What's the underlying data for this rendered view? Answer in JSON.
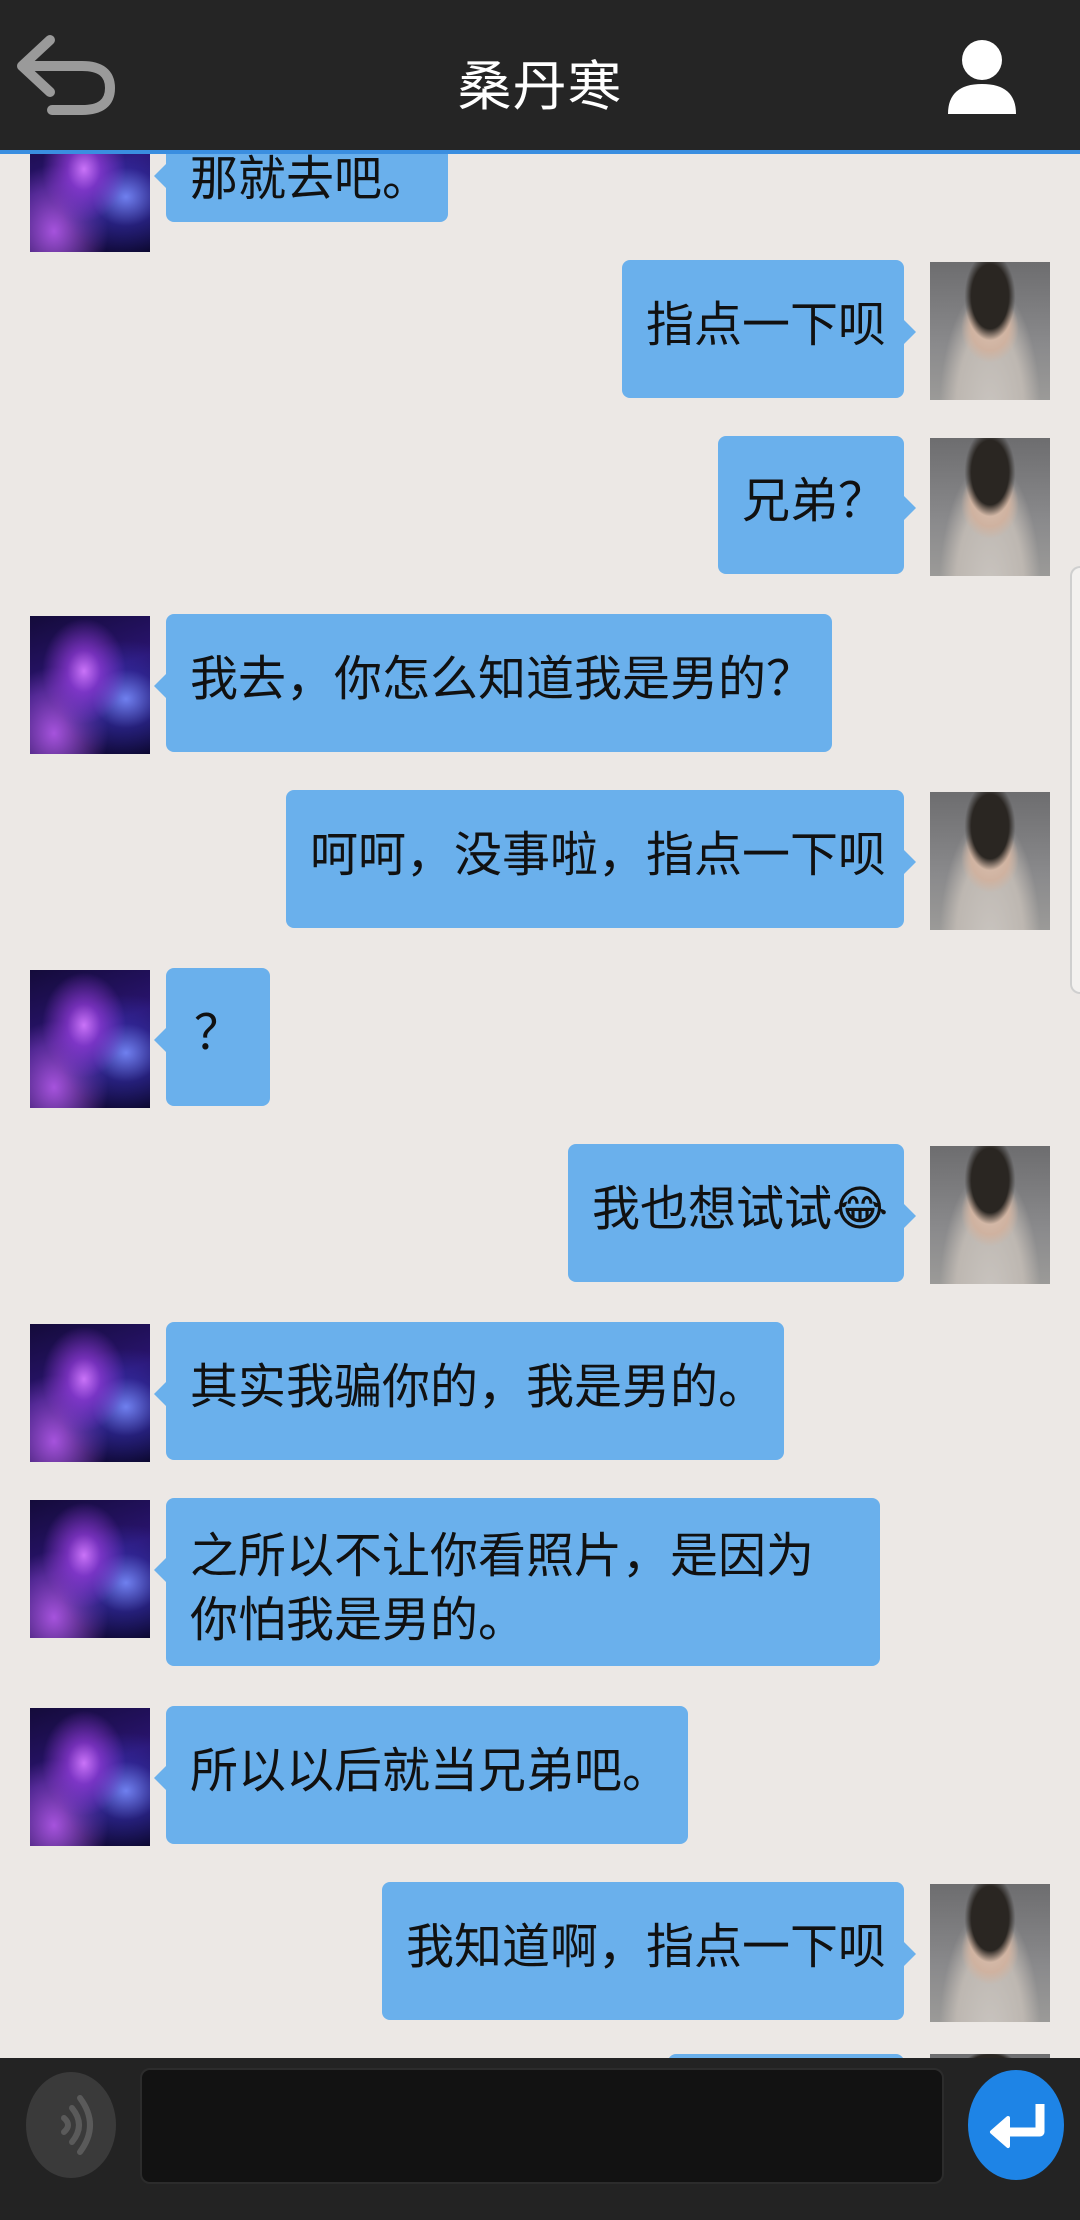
{
  "header": {
    "title": "桑丹寒"
  },
  "messages": [
    {
      "side": "left",
      "text": "那就去吧。"
    },
    {
      "side": "right",
      "text": "指点一下呗"
    },
    {
      "side": "right",
      "text": "兄弟？"
    },
    {
      "side": "left",
      "text": "我去，你怎么知道我是男的？"
    },
    {
      "side": "right",
      "text": "呵呵，没事啦，指点一下呗"
    },
    {
      "side": "left",
      "text": "？"
    },
    {
      "side": "right",
      "text": "我也想试试😂"
    },
    {
      "side": "left",
      "text": "其实我骗你的，我是男的。"
    },
    {
      "side": "left",
      "text": "之所以不让你看照片，是因为你怕我是男的。"
    },
    {
      "side": "left",
      "text": "所以以后就当兄弟吧。"
    },
    {
      "side": "right",
      "text": "我知道啊，指点一下呗"
    }
  ],
  "input": {
    "value": ""
  },
  "icons": {
    "back": "back-arrow-icon",
    "profile": "person-icon",
    "voice": "voice-wave-icon",
    "send": "enter-return-icon"
  },
  "colors": {
    "bubble": "#6AB0EC",
    "header": "#252525",
    "accent": "#3A8EE0",
    "background": "#ECE8E5"
  }
}
